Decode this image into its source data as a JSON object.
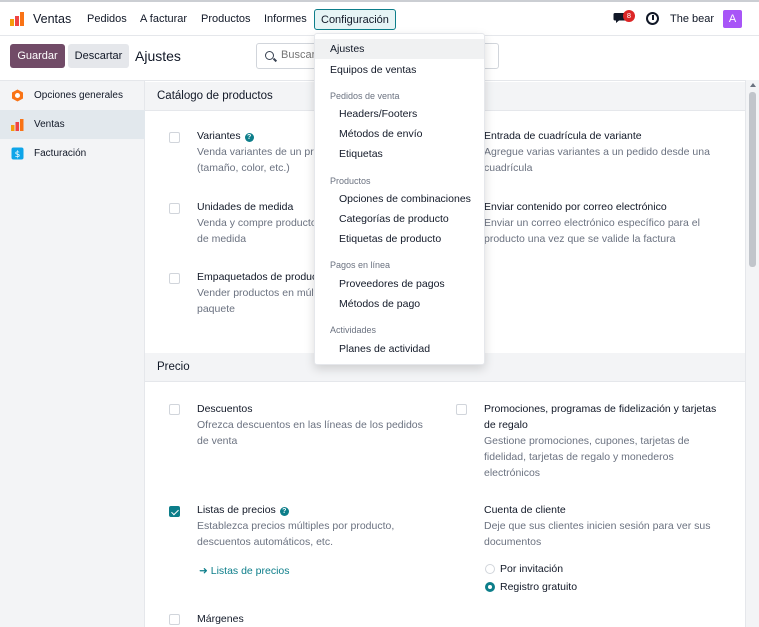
{
  "navbar": {
    "app_name": "Ventas",
    "menu": [
      "Pedidos",
      "A facturar",
      "Productos",
      "Informes"
    ],
    "active_menu": "Configuración",
    "notification_count": "8",
    "user_name": "The bear",
    "avatar_letter": "A"
  },
  "control_panel": {
    "save_label": "Guardar",
    "discard_label": "Descartar",
    "breadcrumb": "Ajustes",
    "search_placeholder": "Buscar..."
  },
  "sidebar": {
    "items": [
      {
        "label": "Opciones generales",
        "icon": "settings-app-icon",
        "active": false
      },
      {
        "label": "Ventas",
        "icon": "sales-app-icon",
        "active": true
      },
      {
        "label": "Facturación",
        "icon": "invoicing-app-icon",
        "active": false
      }
    ]
  },
  "sections": {
    "catalog": {
      "title": "Catálogo de productos",
      "variantes": {
        "title": "Variantes",
        "desc": "Venda variantes de un pr",
        "desc2": "(tamaño, color, etc.)",
        "checked": false
      },
      "grid": {
        "title": "Entrada de cuadrícula de variante",
        "desc": "Agregue varias variantes a un pedido desde una",
        "desc2": "cuadrícula"
      },
      "units": {
        "title": "Unidades de medida",
        "desc": "Venda y compre producto",
        "desc2": "de medida",
        "checked": false
      },
      "email": {
        "title": "Enviar contenido por correo electrónico",
        "desc": "Enviar un correo electrónico específico para el",
        "desc2": "producto una vez que se valide la factura"
      },
      "packaging": {
        "title": "Empaquetados de produc",
        "desc": "Vender productos en múlt",
        "desc2": "paquete",
        "checked": false
      }
    },
    "price": {
      "title": "Precio",
      "discounts": {
        "title": "Descuentos",
        "desc": "Ofrezca descuentos en las líneas de los pedidos",
        "desc2": "de venta",
        "checked": false
      },
      "promotions": {
        "title": "Promociones, programas de fidelización y tarjetas",
        "title2": "de regalo",
        "desc": "Gestione promociones, cupones, tarjetas de",
        "desc2": "fidelidad, tarjetas de regalo y monederos",
        "desc3": "electrónicos",
        "checked": false
      },
      "pricelists": {
        "title": "Listas de precios",
        "desc": "Establezca precios múltiples por producto,",
        "desc2": "descuentos automáticos, etc.",
        "link": "Listas de precios",
        "checked": true
      },
      "customer_account": {
        "title": "Cuenta de cliente",
        "desc": "Deje que sus clientes inicien sesión para ver sus",
        "desc2": "documentos",
        "options": [
          "Por invitación",
          "Registro gratuito"
        ],
        "selected": "Registro gratuito"
      },
      "margins": {
        "title": "Márgenes",
        "checked": false
      }
    }
  },
  "dropdown": {
    "ajustes": "Ajustes",
    "equipos": "Equipos de ventas",
    "group_pedidos": "Pedidos de venta",
    "headers": "Headers/Footers",
    "envio": "Métodos de envío",
    "etiquetas": "Etiquetas",
    "group_productos": "Productos",
    "combinaciones": "Opciones de combinaciones",
    "categorias": "Categorías de producto",
    "etiquetas_producto": "Etiquetas de producto",
    "group_pagos": "Pagos en línea",
    "proveedores": "Proveedores de pagos",
    "metodos_pago": "Métodos de pago",
    "group_actividades": "Actividades",
    "planes": "Planes de actividad"
  },
  "colors": {
    "brand": "#714b67",
    "accent": "#0d7e8a",
    "badge": "#dc2626",
    "avatar": "#a855f7"
  }
}
